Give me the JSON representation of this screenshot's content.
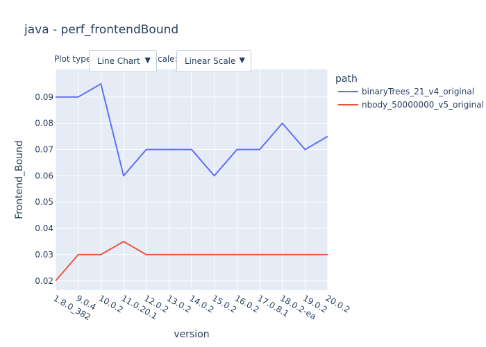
{
  "chart_data": {
    "type": "line",
    "title": "java - perf_frontendBound",
    "xlabel": "version",
    "ylabel": "Frontend_Bound",
    "categories": [
      "1.8.0_382",
      "9.0.4",
      "10.0.2",
      "11.0.20.1",
      "12.0.2",
      "13.0.2",
      "14.0.2",
      "15.0.2",
      "16.0.2",
      "17.0.8.1",
      "18.0.2-ea",
      "19.0.2",
      "20.0.2"
    ],
    "ylim": [
      0.0165,
      0.1005
    ],
    "yticks": [
      0.02,
      0.03,
      0.04,
      0.05,
      0.06,
      0.07,
      0.08,
      0.09
    ],
    "ytick_labels": [
      "0.02",
      "0.03",
      "0.04",
      "0.05",
      "0.06",
      "0.07",
      "0.08",
      "0.09"
    ],
    "grid": true,
    "legend_title": "path",
    "legend_position": "right",
    "series": [
      {
        "name": "binaryTrees_21_v4_original",
        "color": "#636efa",
        "values": [
          0.09,
          0.09,
          0.095,
          0.06,
          0.07,
          0.07,
          0.07,
          0.06,
          0.07,
          0.07,
          0.08,
          0.07,
          0.075
        ]
      },
      {
        "name": "nbody_50000000_v5_original",
        "color": "#ef553b",
        "values": [
          0.02,
          0.03,
          0.03,
          0.035,
          0.03,
          0.03,
          0.03,
          0.03,
          0.03,
          0.03,
          0.03,
          0.03,
          0.03
        ]
      }
    ]
  },
  "controls": {
    "plot_type_label": "Plot type",
    "plot_type_value": "Line Chart",
    "scale_label": "cale:",
    "scale_value": "Linear Scale"
  }
}
